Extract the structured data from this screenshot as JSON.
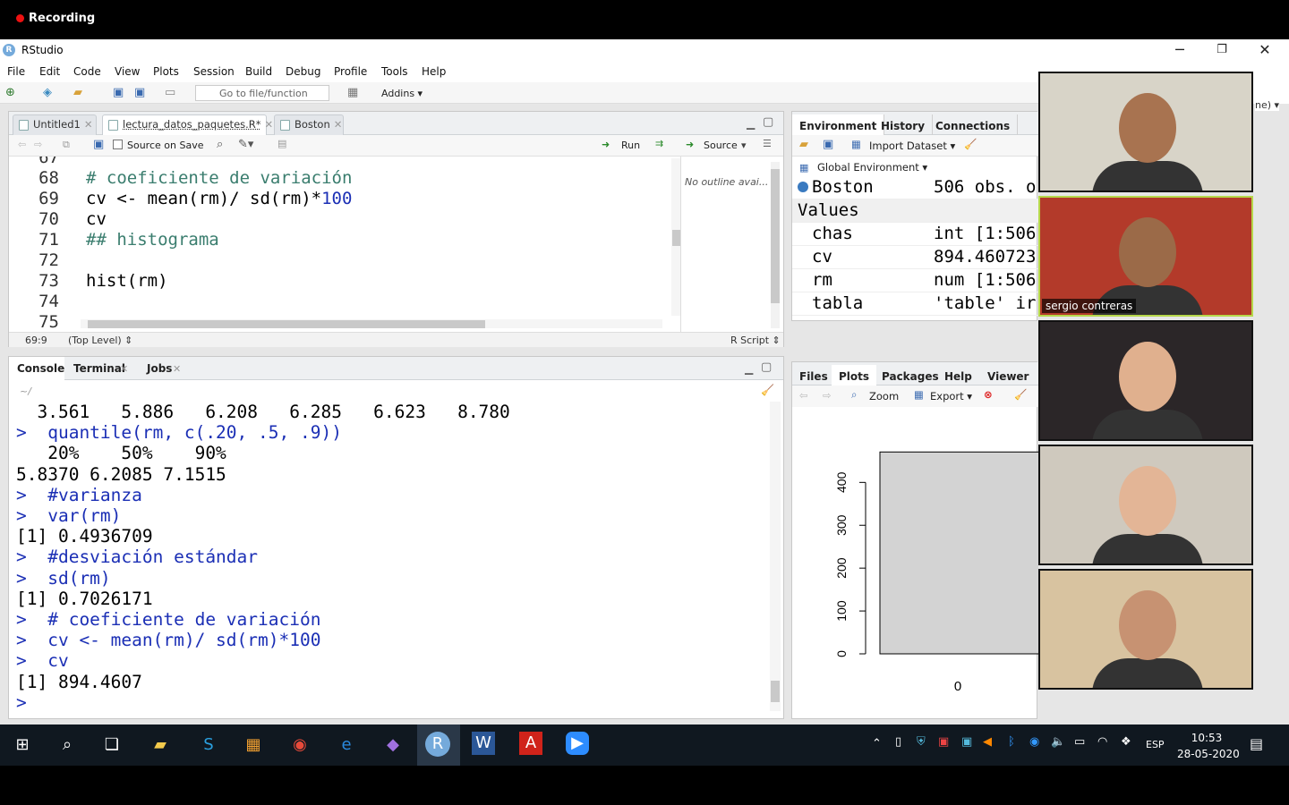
{
  "recording": {
    "label": "Recording"
  },
  "window": {
    "title": "RStudio",
    "logo": "R",
    "minimize": "─",
    "restore": "❐",
    "close": "✕"
  },
  "menu": [
    "File",
    "Edit",
    "Code",
    "View",
    "Plots",
    "Session",
    "Build",
    "Debug",
    "Profile",
    "Tools",
    "Help"
  ],
  "toolbar": {
    "goto_placeholder": "Go to file/function",
    "addins": "Addins ▾"
  },
  "editor": {
    "tabs": [
      {
        "label": "Untitled1",
        "active": false
      },
      {
        "label": "lectura_datos_paquetes.R*",
        "active": true
      },
      {
        "label": "Boston",
        "active": false
      }
    ],
    "source_on_save": "Source on Save",
    "run": "Run",
    "source": "Source",
    "outline": "No outline avai...",
    "lines": [
      {
        "n": "67",
        "code": "",
        "type": "plain"
      },
      {
        "n": "68",
        "code": "# coeficiente de variación",
        "type": "comment"
      },
      {
        "n": "69",
        "code": "cv <- mean(rm)/ sd(rm)*",
        "num": "100",
        "type": "mixed"
      },
      {
        "n": "70",
        "code": "cv",
        "type": "plain"
      },
      {
        "n": "71",
        "code": "## histograma",
        "type": "comment"
      },
      {
        "n": "72",
        "code": "",
        "type": "plain"
      },
      {
        "n": "73",
        "code": "hist(rm)",
        "type": "plain"
      },
      {
        "n": "74",
        "code": "",
        "type": "plain"
      },
      {
        "n": "75",
        "code": "",
        "type": "plain"
      }
    ],
    "status": {
      "position": "69:9",
      "scope": "(Top Level) ⇕",
      "type": "R Script ⇕"
    }
  },
  "console": {
    "tabs": [
      "Console",
      "Terminal",
      "Jobs"
    ],
    "path": "~/",
    "lines": [
      {
        "text": "  3.561   5.886   6.208   6.285   6.623   8.780",
        "cmd": false
      },
      {
        "text": ">  quantile(rm, c(.20, .5, .9))",
        "cmd": true
      },
      {
        "text": "   20%    50%    90% ",
        "cmd": false
      },
      {
        "text": "5.8370 6.2085 7.1515 ",
        "cmd": false
      },
      {
        "text": ">  #varianza",
        "cmd": true
      },
      {
        "text": ">  var(rm)",
        "cmd": true
      },
      {
        "text": "[1] 0.4936709",
        "cmd": false
      },
      {
        "text": ">  #desviación estándar",
        "cmd": true
      },
      {
        "text": ">  sd(rm)",
        "cmd": true
      },
      {
        "text": "[1] 0.7026171",
        "cmd": false
      },
      {
        "text": ">  # coeficiente de variación",
        "cmd": true
      },
      {
        "text": ">  cv <- mean(rm)/ sd(rm)*100",
        "cmd": true
      },
      {
        "text": ">  cv",
        "cmd": true
      },
      {
        "text": "[1] 894.4607",
        "cmd": false
      },
      {
        "text": "> ",
        "cmd": true
      }
    ]
  },
  "environment": {
    "tabs": [
      "Environment",
      "History",
      "Connections"
    ],
    "import_dataset": "Import Dataset ▾",
    "global_env": "Global Environment ▾",
    "data_row": {
      "name": "Boston",
      "value": "506 obs. o"
    },
    "values_header": "Values",
    "values": [
      {
        "name": "chas",
        "value": "int [1:506"
      },
      {
        "name": "cv",
        "value": "894.460723"
      },
      {
        "name": "rm",
        "value": "num [1:506"
      },
      {
        "name": "tabla",
        "value": "'table' ir"
      }
    ]
  },
  "files": {
    "tabs": [
      "Files",
      "Plots",
      "Packages",
      "Help",
      "Viewer"
    ],
    "zoom": "Zoom",
    "export": "Export ▾"
  },
  "chart_data": {
    "type": "bar",
    "categories": [
      "0"
    ],
    "values": [
      471
    ],
    "yticks": [
      0,
      100,
      200,
      300,
      400
    ],
    "ylim": [
      0,
      480
    ],
    "xlabel": "",
    "ylabel": "",
    "title": "",
    "bar_color": "#d3d3d3"
  },
  "zoom_participants": [
    {
      "name": "",
      "active": false,
      "bg": "#d8d4c8",
      "skin": "#a87350"
    },
    {
      "name": "sergio contreras",
      "active": true,
      "bg": "#b33a2a",
      "skin": "#9b6a48"
    },
    {
      "name": "",
      "active": false,
      "bg": "#2b2628",
      "skin": "#e0b08e"
    },
    {
      "name": "",
      "active": false,
      "bg": "#cfc9be",
      "skin": "#e3b596"
    },
    {
      "name": "",
      "active": false,
      "bg": "#d8c3a0",
      "skin": "#c79272"
    }
  ],
  "taskbar": {
    "lang": "ESP",
    "time": "10:53",
    "date": "28-05-2020",
    "overflow_text": "ne) ▾"
  }
}
